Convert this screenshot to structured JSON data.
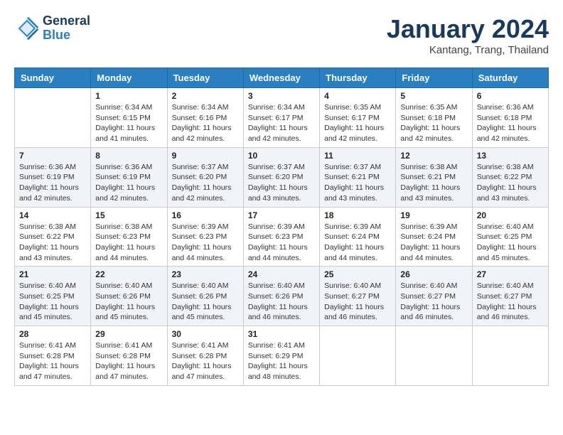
{
  "logo": {
    "line1": "General",
    "line2": "Blue"
  },
  "title": "January 2024",
  "location": "Kantang, Trang, Thailand",
  "days_header": [
    "Sunday",
    "Monday",
    "Tuesday",
    "Wednesday",
    "Thursday",
    "Friday",
    "Saturday"
  ],
  "weeks": [
    [
      {
        "num": "",
        "sunrise": "",
        "sunset": "",
        "daylight": ""
      },
      {
        "num": "1",
        "sunrise": "Sunrise: 6:34 AM",
        "sunset": "Sunset: 6:15 PM",
        "daylight": "Daylight: 11 hours and 41 minutes."
      },
      {
        "num": "2",
        "sunrise": "Sunrise: 6:34 AM",
        "sunset": "Sunset: 6:16 PM",
        "daylight": "Daylight: 11 hours and 42 minutes."
      },
      {
        "num": "3",
        "sunrise": "Sunrise: 6:34 AM",
        "sunset": "Sunset: 6:17 PM",
        "daylight": "Daylight: 11 hours and 42 minutes."
      },
      {
        "num": "4",
        "sunrise": "Sunrise: 6:35 AM",
        "sunset": "Sunset: 6:17 PM",
        "daylight": "Daylight: 11 hours and 42 minutes."
      },
      {
        "num": "5",
        "sunrise": "Sunrise: 6:35 AM",
        "sunset": "Sunset: 6:18 PM",
        "daylight": "Daylight: 11 hours and 42 minutes."
      },
      {
        "num": "6",
        "sunrise": "Sunrise: 6:36 AM",
        "sunset": "Sunset: 6:18 PM",
        "daylight": "Daylight: 11 hours and 42 minutes."
      }
    ],
    [
      {
        "num": "7",
        "sunrise": "Sunrise: 6:36 AM",
        "sunset": "Sunset: 6:19 PM",
        "daylight": "Daylight: 11 hours and 42 minutes."
      },
      {
        "num": "8",
        "sunrise": "Sunrise: 6:36 AM",
        "sunset": "Sunset: 6:19 PM",
        "daylight": "Daylight: 11 hours and 42 minutes."
      },
      {
        "num": "9",
        "sunrise": "Sunrise: 6:37 AM",
        "sunset": "Sunset: 6:20 PM",
        "daylight": "Daylight: 11 hours and 42 minutes."
      },
      {
        "num": "10",
        "sunrise": "Sunrise: 6:37 AM",
        "sunset": "Sunset: 6:20 PM",
        "daylight": "Daylight: 11 hours and 43 minutes."
      },
      {
        "num": "11",
        "sunrise": "Sunrise: 6:37 AM",
        "sunset": "Sunset: 6:21 PM",
        "daylight": "Daylight: 11 hours and 43 minutes."
      },
      {
        "num": "12",
        "sunrise": "Sunrise: 6:38 AM",
        "sunset": "Sunset: 6:21 PM",
        "daylight": "Daylight: 11 hours and 43 minutes."
      },
      {
        "num": "13",
        "sunrise": "Sunrise: 6:38 AM",
        "sunset": "Sunset: 6:22 PM",
        "daylight": "Daylight: 11 hours and 43 minutes."
      }
    ],
    [
      {
        "num": "14",
        "sunrise": "Sunrise: 6:38 AM",
        "sunset": "Sunset: 6:22 PM",
        "daylight": "Daylight: 11 hours and 43 minutes."
      },
      {
        "num": "15",
        "sunrise": "Sunrise: 6:38 AM",
        "sunset": "Sunset: 6:23 PM",
        "daylight": "Daylight: 11 hours and 44 minutes."
      },
      {
        "num": "16",
        "sunrise": "Sunrise: 6:39 AM",
        "sunset": "Sunset: 6:23 PM",
        "daylight": "Daylight: 11 hours and 44 minutes."
      },
      {
        "num": "17",
        "sunrise": "Sunrise: 6:39 AM",
        "sunset": "Sunset: 6:23 PM",
        "daylight": "Daylight: 11 hours and 44 minutes."
      },
      {
        "num": "18",
        "sunrise": "Sunrise: 6:39 AM",
        "sunset": "Sunset: 6:24 PM",
        "daylight": "Daylight: 11 hours and 44 minutes."
      },
      {
        "num": "19",
        "sunrise": "Sunrise: 6:39 AM",
        "sunset": "Sunset: 6:24 PM",
        "daylight": "Daylight: 11 hours and 44 minutes."
      },
      {
        "num": "20",
        "sunrise": "Sunrise: 6:40 AM",
        "sunset": "Sunset: 6:25 PM",
        "daylight": "Daylight: 11 hours and 45 minutes."
      }
    ],
    [
      {
        "num": "21",
        "sunrise": "Sunrise: 6:40 AM",
        "sunset": "Sunset: 6:25 PM",
        "daylight": "Daylight: 11 hours and 45 minutes."
      },
      {
        "num": "22",
        "sunrise": "Sunrise: 6:40 AM",
        "sunset": "Sunset: 6:26 PM",
        "daylight": "Daylight: 11 hours and 45 minutes."
      },
      {
        "num": "23",
        "sunrise": "Sunrise: 6:40 AM",
        "sunset": "Sunset: 6:26 PM",
        "daylight": "Daylight: 11 hours and 45 minutes."
      },
      {
        "num": "24",
        "sunrise": "Sunrise: 6:40 AM",
        "sunset": "Sunset: 6:26 PM",
        "daylight": "Daylight: 11 hours and 46 minutes."
      },
      {
        "num": "25",
        "sunrise": "Sunrise: 6:40 AM",
        "sunset": "Sunset: 6:27 PM",
        "daylight": "Daylight: 11 hours and 46 minutes."
      },
      {
        "num": "26",
        "sunrise": "Sunrise: 6:40 AM",
        "sunset": "Sunset: 6:27 PM",
        "daylight": "Daylight: 11 hours and 46 minutes."
      },
      {
        "num": "27",
        "sunrise": "Sunrise: 6:40 AM",
        "sunset": "Sunset: 6:27 PM",
        "daylight": "Daylight: 11 hours and 46 minutes."
      }
    ],
    [
      {
        "num": "28",
        "sunrise": "Sunrise: 6:41 AM",
        "sunset": "Sunset: 6:28 PM",
        "daylight": "Daylight: 11 hours and 47 minutes."
      },
      {
        "num": "29",
        "sunrise": "Sunrise: 6:41 AM",
        "sunset": "Sunset: 6:28 PM",
        "daylight": "Daylight: 11 hours and 47 minutes."
      },
      {
        "num": "30",
        "sunrise": "Sunrise: 6:41 AM",
        "sunset": "Sunset: 6:28 PM",
        "daylight": "Daylight: 11 hours and 47 minutes."
      },
      {
        "num": "31",
        "sunrise": "Sunrise: 6:41 AM",
        "sunset": "Sunset: 6:29 PM",
        "daylight": "Daylight: 11 hours and 48 minutes."
      },
      {
        "num": "",
        "sunrise": "",
        "sunset": "",
        "daylight": ""
      },
      {
        "num": "",
        "sunrise": "",
        "sunset": "",
        "daylight": ""
      },
      {
        "num": "",
        "sunrise": "",
        "sunset": "",
        "daylight": ""
      }
    ]
  ]
}
